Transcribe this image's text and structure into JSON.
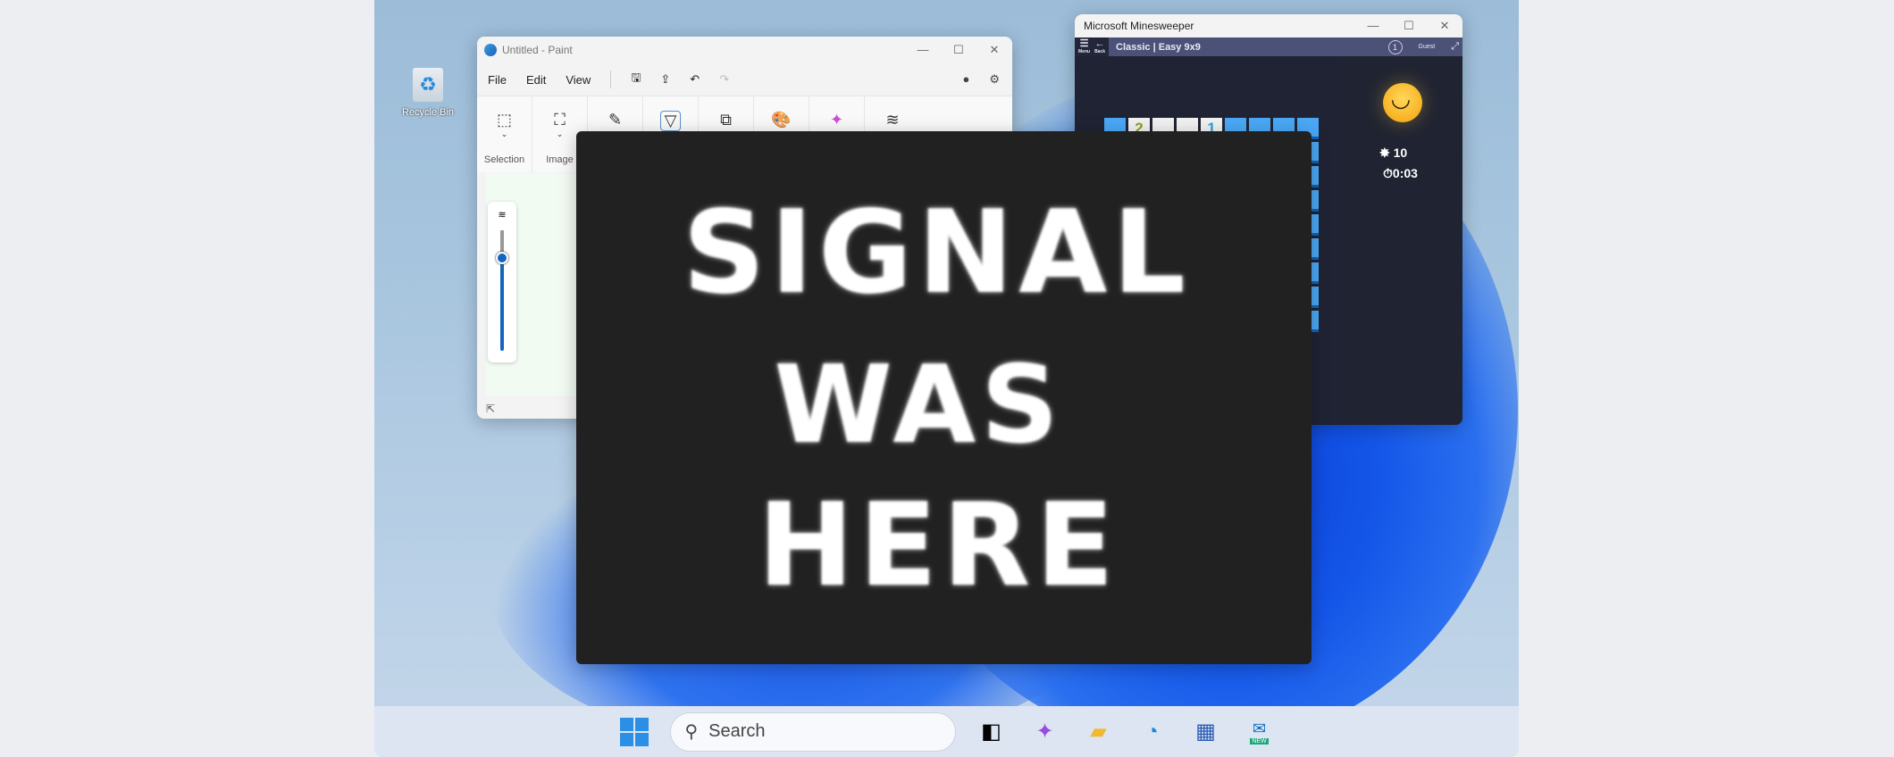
{
  "desktop": {
    "recycle_bin_label": "Recycle Bin"
  },
  "paint": {
    "title": "Untitled - Paint",
    "menu": [
      "File",
      "Edit",
      "View"
    ],
    "ribbon_groups": [
      {
        "label": "Selection"
      },
      {
        "label": "Image"
      }
    ]
  },
  "minesweeper": {
    "title": "Microsoft Minesweeper",
    "menu_label": "Menu",
    "back_label": "Back",
    "mode": "Classic | Easy 9x9",
    "user": "Guest",
    "level_badge": "1",
    "top_row": [
      "",
      "2",
      "",
      "",
      "1",
      "",
      "",
      "",
      ""
    ],
    "mines": "10",
    "timer": "0:03"
  },
  "poster": {
    "lines": [
      "SIGNAL",
      "WAS",
      "HERE"
    ]
  },
  "taskbar": {
    "search_placeholder": "Search",
    "outlook_badge": "NEW"
  },
  "colors": {
    "accent": "#1565c0",
    "tile": "#4aa8f5"
  }
}
